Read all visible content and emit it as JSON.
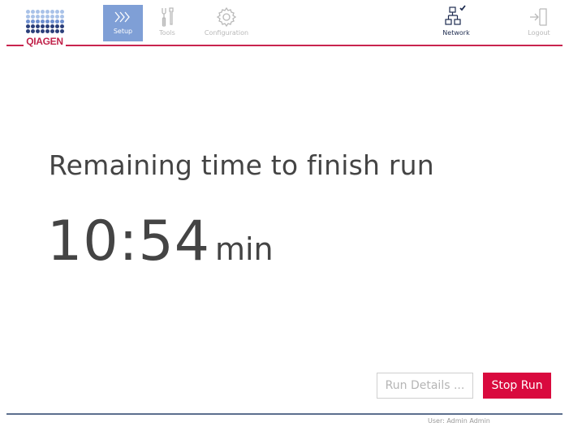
{
  "brand": {
    "logo_text": "QIAGEN",
    "accent": "#c9244f"
  },
  "nav": {
    "items": [
      {
        "label": "Setup",
        "icon": "setup-icon",
        "active": true
      },
      {
        "label": "Tools",
        "icon": "tools-icon",
        "active": false
      },
      {
        "label": "Configuration",
        "icon": "configuration-icon",
        "active": false
      },
      {
        "label": "Network",
        "icon": "network-icon",
        "active": false,
        "status": "connected"
      },
      {
        "label": "Logout",
        "icon": "logout-icon",
        "active": false
      }
    ]
  },
  "main": {
    "title": "Remaining time to finish run",
    "time_value": "10:54",
    "time_unit": "min"
  },
  "actions": {
    "details_label": "Run Details ...",
    "details_enabled": false,
    "stop_label": "Stop Run",
    "stop_color": "#d90a3e"
  },
  "footer": {
    "user_label": "User: Admin Admin"
  }
}
